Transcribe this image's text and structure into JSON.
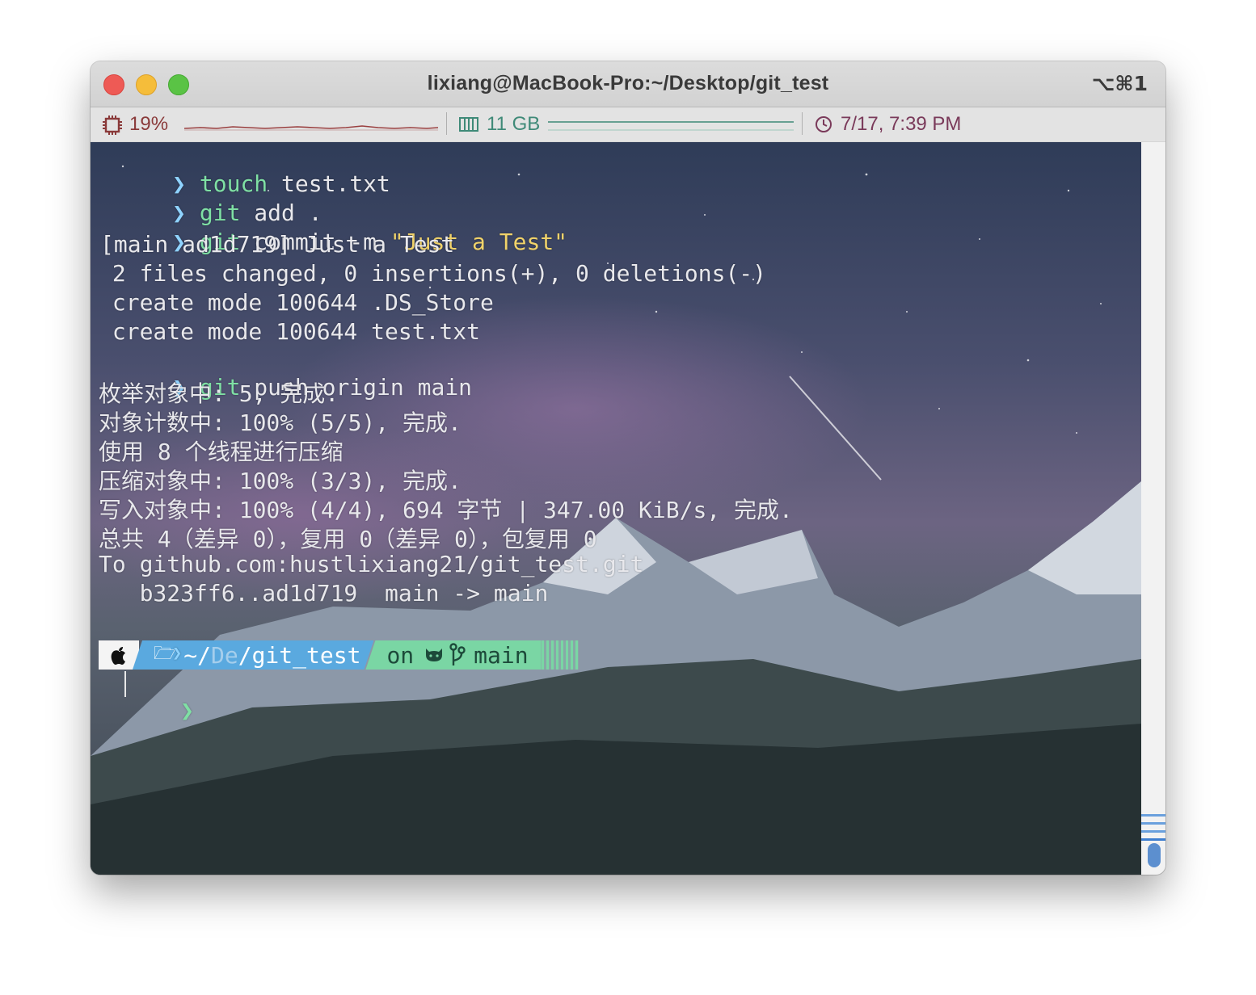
{
  "window": {
    "title": "lixiang@MacBook-Pro:~/Desktop/git_test",
    "shortcut": "⌥⌘1"
  },
  "statusbar": {
    "cpu": {
      "icon": "cpu-icon",
      "value": "19%",
      "color": "#8a3a3a"
    },
    "memory": {
      "icon": "memory-icon",
      "value": "11 GB",
      "color": "#3f8a78"
    },
    "clock": {
      "icon": "clock-icon",
      "value": "7/17, 7:39 PM",
      "color": "#7a3a5a"
    }
  },
  "terminal": {
    "prompt_symbol": "❯",
    "lines": [
      {
        "cmd": "touch",
        "rest": " test.txt"
      },
      {
        "cmd": "git",
        "rest": " add ."
      },
      {
        "cmd": "git",
        "rest": " commit -m ",
        "str": "\"Just a Test\""
      },
      {
        "text": "[main ad1d719] Just a Test"
      },
      {
        "text": " 2 files changed, 0 insertions(+), 0 deletions(-)"
      },
      {
        "text": " create mode 100644 .DS_Store"
      },
      {
        "text": " create mode 100644 test.txt"
      },
      {
        "cmd": "git",
        "rest": " push origin main"
      },
      {
        "text": "枚举对象中: 5, 完成."
      },
      {
        "text": "对象计数中: 100% (5/5), 完成."
      },
      {
        "text": "使用 8 个线程进行压缩"
      },
      {
        "text": "压缩对象中: 100% (3/3), 完成."
      },
      {
        "text": "写入对象中: 100% (4/4), 694 字节 | 347.00 KiB/s, 完成."
      },
      {
        "text": "总共 4（差异 0），复用 0（差异 0），包复用 0"
      },
      {
        "text": "To github.com:hustlixiang21/git_test.git"
      },
      {
        "text": "   b323ff6..ad1d719  main -> main"
      }
    ],
    "powerline": {
      "apple": "",
      "folder_icon": "🗁",
      "path_home": "~/",
      "path_dim": "De",
      "path_tail": "/git_test",
      "on": "on",
      "github_icon": "github-icon",
      "branch_icon": "branch-icon",
      "branch": "main"
    }
  },
  "colors": {
    "arrow": "#8fd3ff",
    "command": "#7fe0a4",
    "string": "#f1d36a",
    "path_segment": "#5aa9df",
    "git_segment": "#7ad6a4"
  }
}
